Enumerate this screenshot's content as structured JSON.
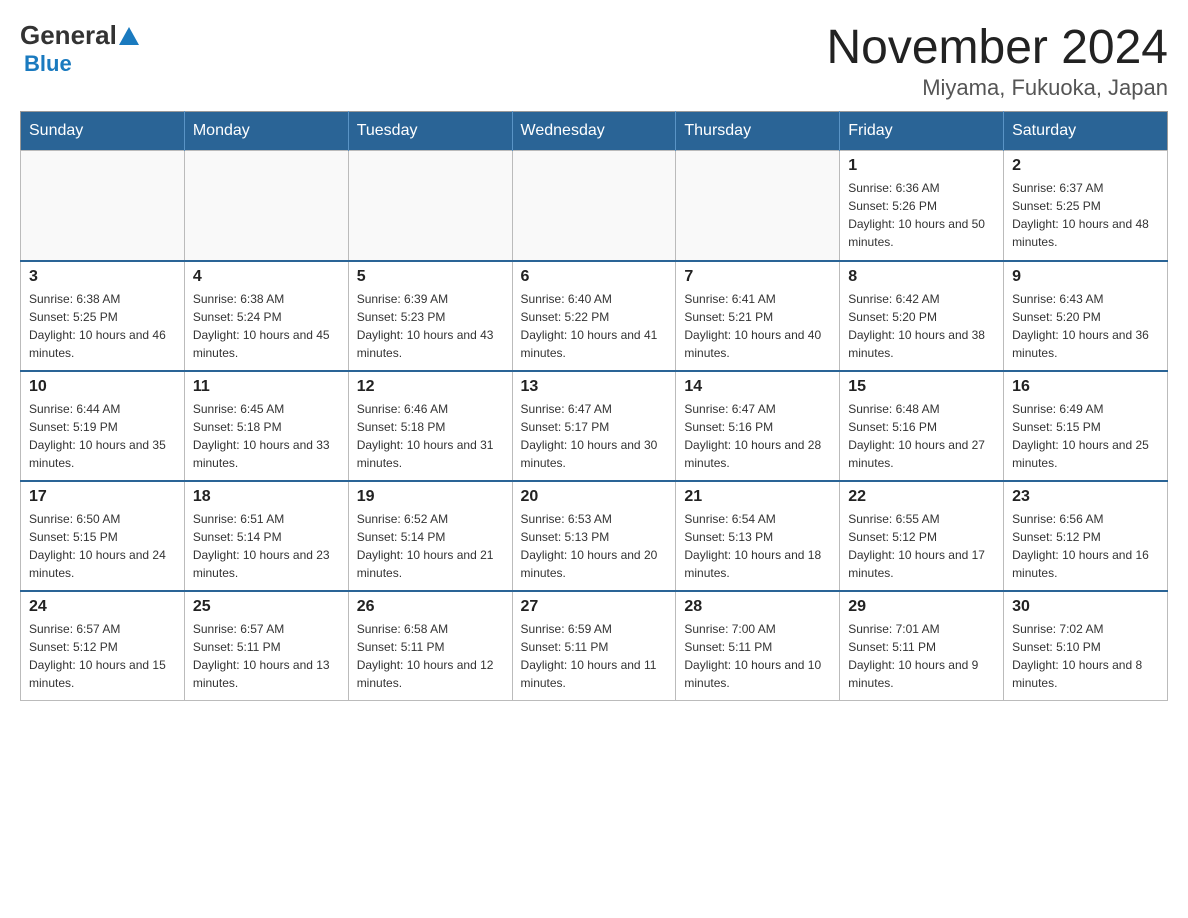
{
  "header": {
    "title": "November 2024",
    "subtitle": "Miyama, Fukuoka, Japan",
    "logo_general": "General",
    "logo_blue": "Blue"
  },
  "weekdays": [
    "Sunday",
    "Monday",
    "Tuesday",
    "Wednesday",
    "Thursday",
    "Friday",
    "Saturday"
  ],
  "weeks": [
    [
      {
        "day": "",
        "info": ""
      },
      {
        "day": "",
        "info": ""
      },
      {
        "day": "",
        "info": ""
      },
      {
        "day": "",
        "info": ""
      },
      {
        "day": "",
        "info": ""
      },
      {
        "day": "1",
        "info": "Sunrise: 6:36 AM\nSunset: 5:26 PM\nDaylight: 10 hours and 50 minutes."
      },
      {
        "day": "2",
        "info": "Sunrise: 6:37 AM\nSunset: 5:25 PM\nDaylight: 10 hours and 48 minutes."
      }
    ],
    [
      {
        "day": "3",
        "info": "Sunrise: 6:38 AM\nSunset: 5:25 PM\nDaylight: 10 hours and 46 minutes."
      },
      {
        "day": "4",
        "info": "Sunrise: 6:38 AM\nSunset: 5:24 PM\nDaylight: 10 hours and 45 minutes."
      },
      {
        "day": "5",
        "info": "Sunrise: 6:39 AM\nSunset: 5:23 PM\nDaylight: 10 hours and 43 minutes."
      },
      {
        "day": "6",
        "info": "Sunrise: 6:40 AM\nSunset: 5:22 PM\nDaylight: 10 hours and 41 minutes."
      },
      {
        "day": "7",
        "info": "Sunrise: 6:41 AM\nSunset: 5:21 PM\nDaylight: 10 hours and 40 minutes."
      },
      {
        "day": "8",
        "info": "Sunrise: 6:42 AM\nSunset: 5:20 PM\nDaylight: 10 hours and 38 minutes."
      },
      {
        "day": "9",
        "info": "Sunrise: 6:43 AM\nSunset: 5:20 PM\nDaylight: 10 hours and 36 minutes."
      }
    ],
    [
      {
        "day": "10",
        "info": "Sunrise: 6:44 AM\nSunset: 5:19 PM\nDaylight: 10 hours and 35 minutes."
      },
      {
        "day": "11",
        "info": "Sunrise: 6:45 AM\nSunset: 5:18 PM\nDaylight: 10 hours and 33 minutes."
      },
      {
        "day": "12",
        "info": "Sunrise: 6:46 AM\nSunset: 5:18 PM\nDaylight: 10 hours and 31 minutes."
      },
      {
        "day": "13",
        "info": "Sunrise: 6:47 AM\nSunset: 5:17 PM\nDaylight: 10 hours and 30 minutes."
      },
      {
        "day": "14",
        "info": "Sunrise: 6:47 AM\nSunset: 5:16 PM\nDaylight: 10 hours and 28 minutes."
      },
      {
        "day": "15",
        "info": "Sunrise: 6:48 AM\nSunset: 5:16 PM\nDaylight: 10 hours and 27 minutes."
      },
      {
        "day": "16",
        "info": "Sunrise: 6:49 AM\nSunset: 5:15 PM\nDaylight: 10 hours and 25 minutes."
      }
    ],
    [
      {
        "day": "17",
        "info": "Sunrise: 6:50 AM\nSunset: 5:15 PM\nDaylight: 10 hours and 24 minutes."
      },
      {
        "day": "18",
        "info": "Sunrise: 6:51 AM\nSunset: 5:14 PM\nDaylight: 10 hours and 23 minutes."
      },
      {
        "day": "19",
        "info": "Sunrise: 6:52 AM\nSunset: 5:14 PM\nDaylight: 10 hours and 21 minutes."
      },
      {
        "day": "20",
        "info": "Sunrise: 6:53 AM\nSunset: 5:13 PM\nDaylight: 10 hours and 20 minutes."
      },
      {
        "day": "21",
        "info": "Sunrise: 6:54 AM\nSunset: 5:13 PM\nDaylight: 10 hours and 18 minutes."
      },
      {
        "day": "22",
        "info": "Sunrise: 6:55 AM\nSunset: 5:12 PM\nDaylight: 10 hours and 17 minutes."
      },
      {
        "day": "23",
        "info": "Sunrise: 6:56 AM\nSunset: 5:12 PM\nDaylight: 10 hours and 16 minutes."
      }
    ],
    [
      {
        "day": "24",
        "info": "Sunrise: 6:57 AM\nSunset: 5:12 PM\nDaylight: 10 hours and 15 minutes."
      },
      {
        "day": "25",
        "info": "Sunrise: 6:57 AM\nSunset: 5:11 PM\nDaylight: 10 hours and 13 minutes."
      },
      {
        "day": "26",
        "info": "Sunrise: 6:58 AM\nSunset: 5:11 PM\nDaylight: 10 hours and 12 minutes."
      },
      {
        "day": "27",
        "info": "Sunrise: 6:59 AM\nSunset: 5:11 PM\nDaylight: 10 hours and 11 minutes."
      },
      {
        "day": "28",
        "info": "Sunrise: 7:00 AM\nSunset: 5:11 PM\nDaylight: 10 hours and 10 minutes."
      },
      {
        "day": "29",
        "info": "Sunrise: 7:01 AM\nSunset: 5:11 PM\nDaylight: 10 hours and 9 minutes."
      },
      {
        "day": "30",
        "info": "Sunrise: 7:02 AM\nSunset: 5:10 PM\nDaylight: 10 hours and 8 minutes."
      }
    ]
  ]
}
